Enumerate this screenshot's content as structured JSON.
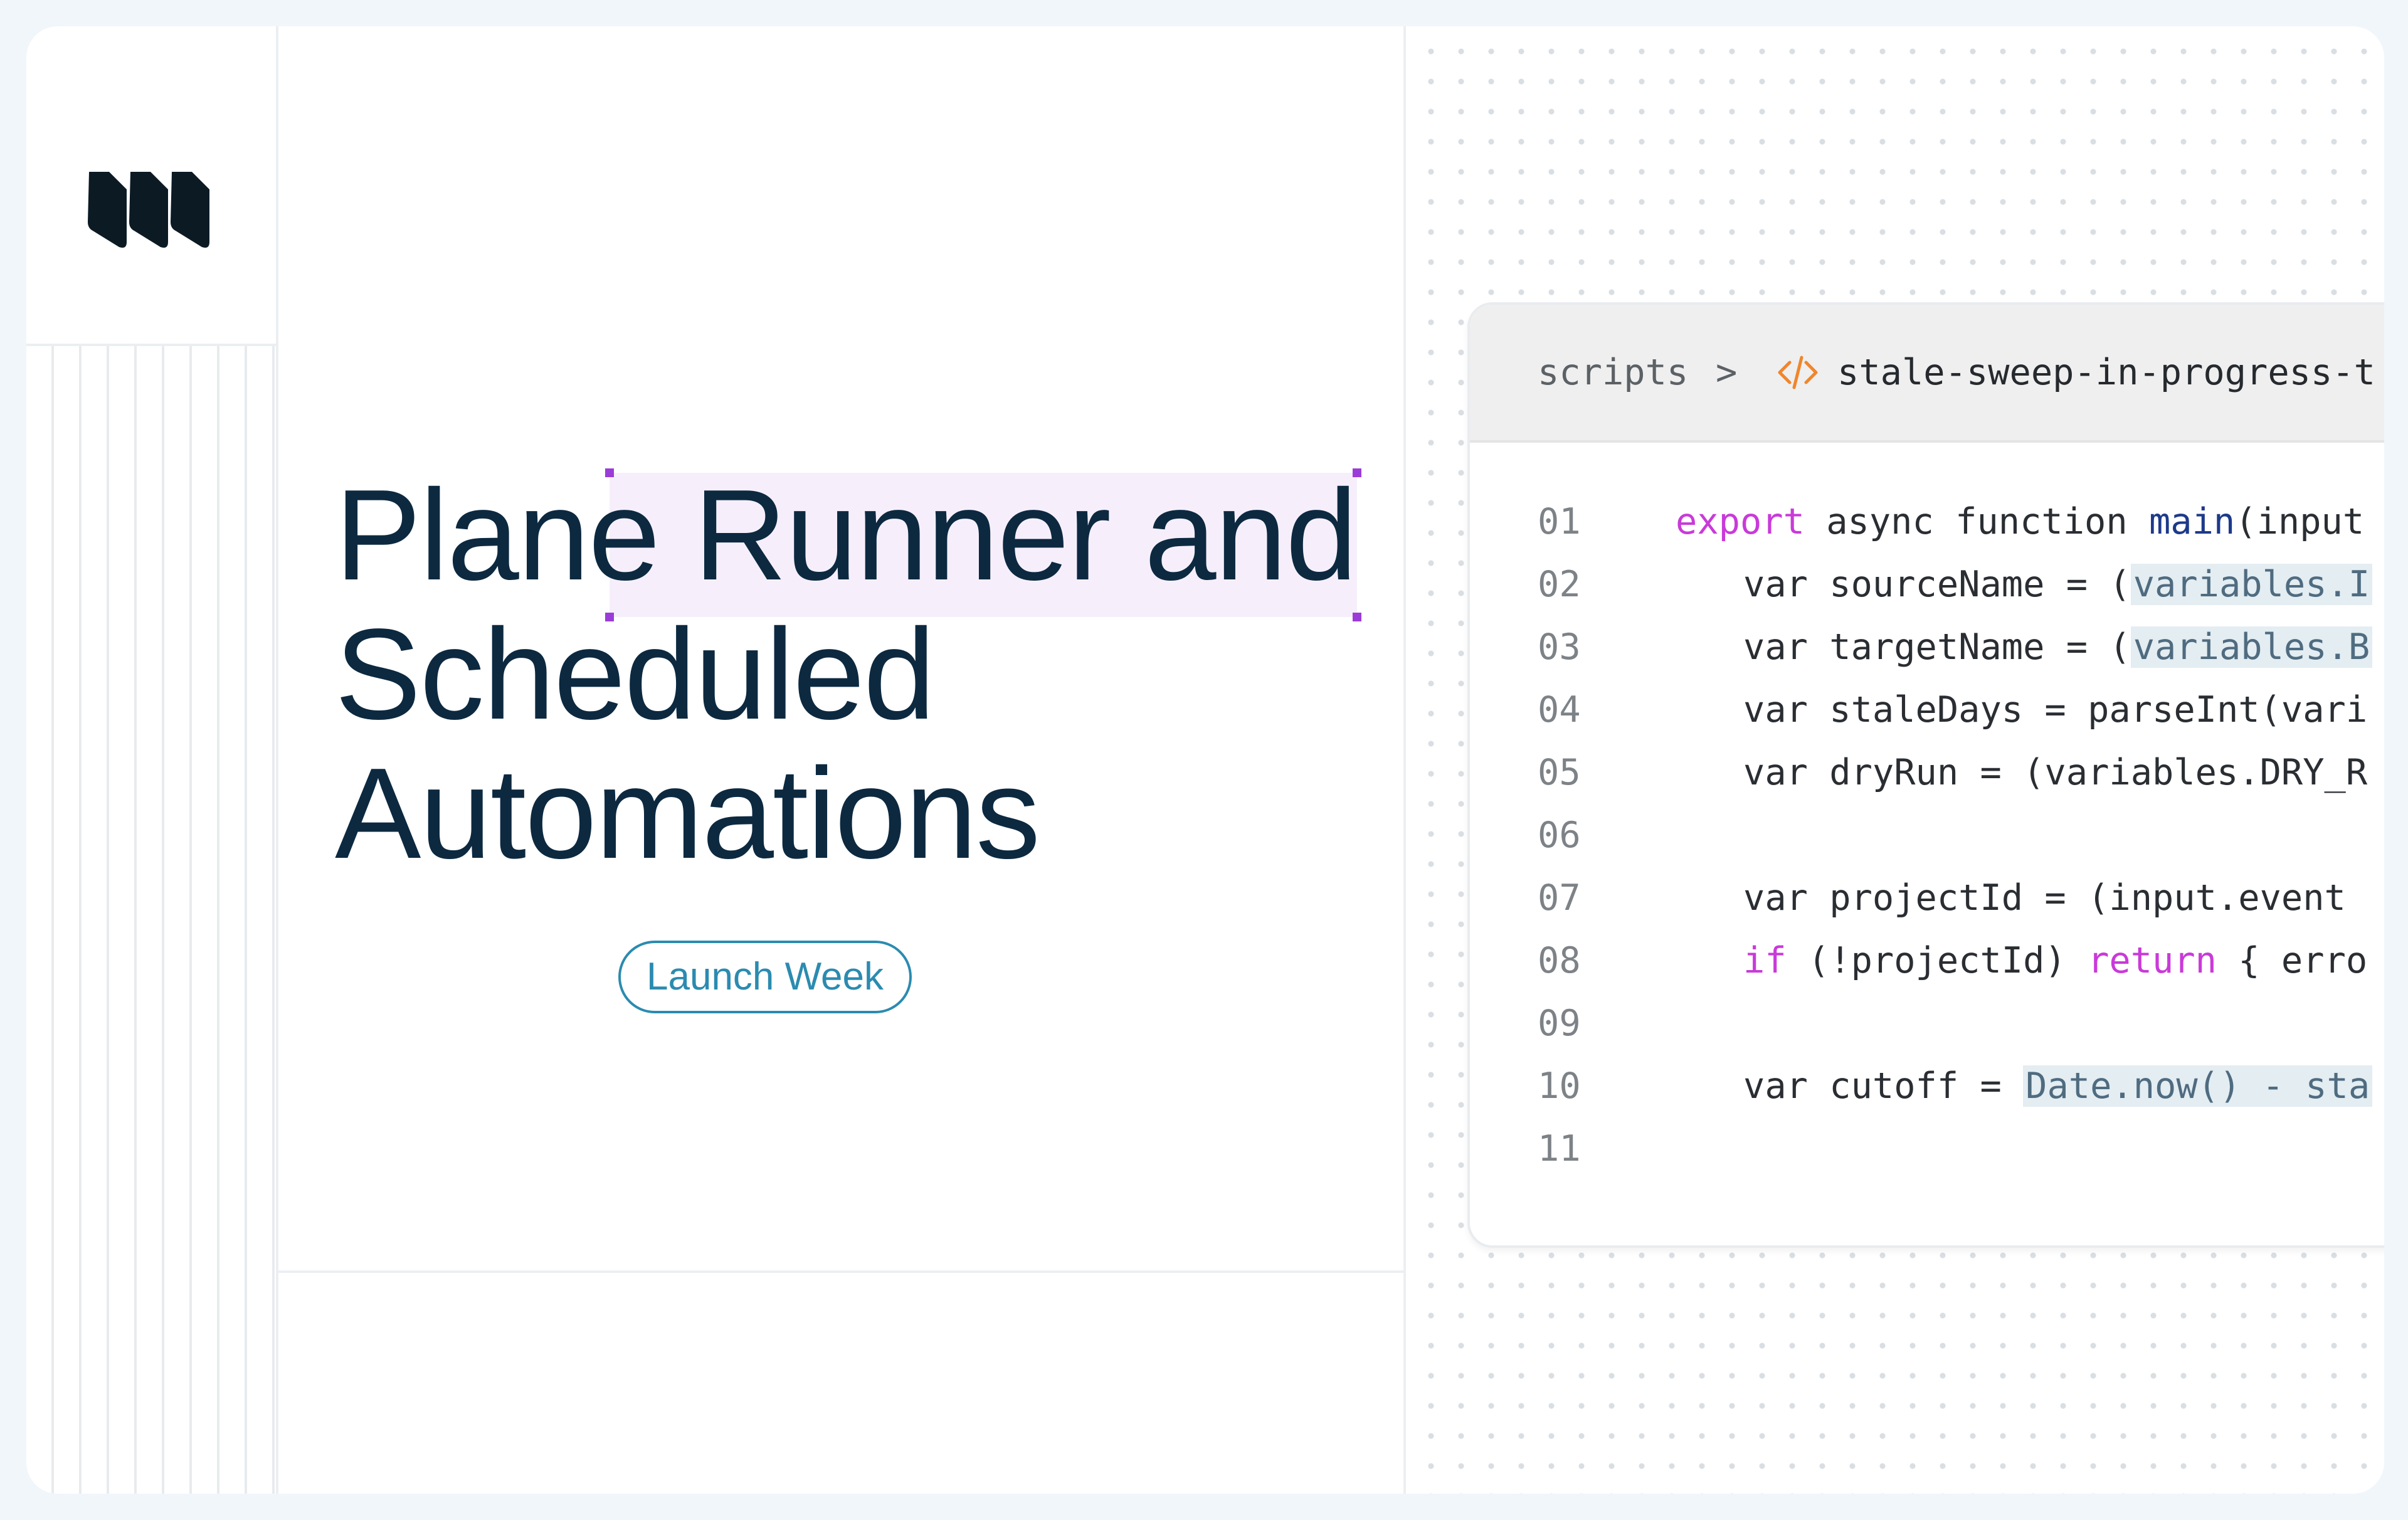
{
  "headline": {
    "highlighted": "Plane Runner",
    "line1_rest": " and",
    "line2": "Scheduled",
    "line3": "Automations"
  },
  "badge": {
    "label": "Launch Week"
  },
  "editor": {
    "breadcrumb_root": "scripts",
    "breadcrumb_separator": ">",
    "file_icon": "code-icon",
    "file_name": "stale-sweep-in-progress-t",
    "lines": [
      {
        "n": "01",
        "code": "export async function main(input"
      },
      {
        "n": "02",
        "code": "var sourceName = (variables.I"
      },
      {
        "n": "03",
        "code": "var targetName = (variables.B"
      },
      {
        "n": "04",
        "code": "var staleDays = parseInt(vari"
      },
      {
        "n": "05",
        "code": "var dryRun = (variables.DRY_R"
      },
      {
        "n": "06",
        "code": ""
      },
      {
        "n": "07",
        "code": "var projectId = (input.event"
      },
      {
        "n": "08",
        "code": "if (!projectId) return { erro"
      },
      {
        "n": "09",
        "code": ""
      },
      {
        "n": "10",
        "code": "var cutoff = Date.now() - sta"
      },
      {
        "n": "11",
        "code": ""
      }
    ]
  },
  "colors": {
    "headline": "#0c2940",
    "accent_badge": "#2b8bb0",
    "selection_handle": "#9b3cd9",
    "keyword": "#c93ad9",
    "function_name": "#1d3a8a",
    "file_icon": "#f0862c"
  }
}
